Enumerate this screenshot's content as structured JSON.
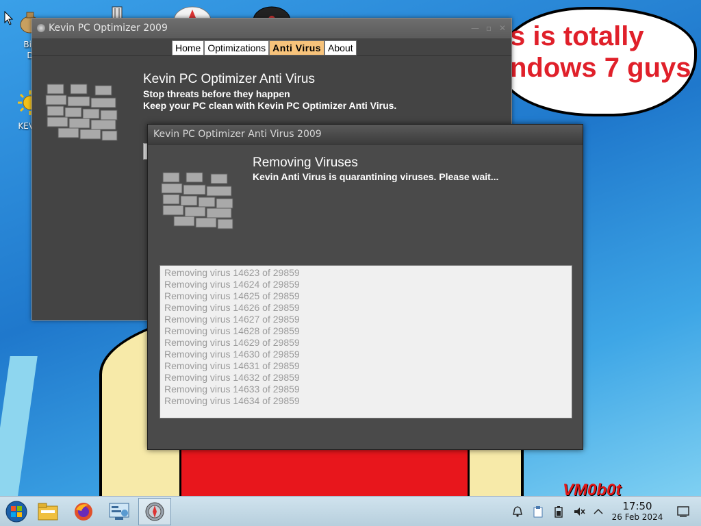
{
  "desktop": {
    "speech_text": "s is totally\nndows 7 guys",
    "watermark": "VM0b0t",
    "icons": [
      {
        "label": "Big\nD"
      },
      {
        "label": "KEVI"
      }
    ]
  },
  "main_window": {
    "title": "Kevin PC Optimizer 2009",
    "tabs": [
      {
        "label": "Home"
      },
      {
        "label": "Optimizations"
      },
      {
        "label": "Anti Virus"
      },
      {
        "label": "About"
      }
    ],
    "active_tab": "Anti Virus",
    "heading": "Kevin PC Optimizer Anti Virus",
    "subtitle_1": "Stop threats before they happen",
    "subtitle_2": "Keep your PC clean with Kevin PC Optimizer Anti Virus."
  },
  "av_dialog": {
    "title": "Kevin PC Optimizer Anti Virus 2009",
    "heading": "Removing Viruses",
    "message": "Kevin Anti Virus is quarantining viruses. Please wait...",
    "log": [
      "Removing virus 14623 of 29859",
      "Removing virus 14624 of 29859",
      "Removing virus 14625 of 29859",
      "Removing virus 14626 of 29859",
      "Removing virus 14627 of 29859",
      "Removing virus 14628 of 29859",
      "Removing virus 14629 of 29859",
      "Removing virus 14630 of 29859",
      "Removing virus 14631 of 29859",
      "Removing virus 14632 of 29859",
      "Removing virus 14633 of 29859",
      "Removing virus 14634 of 29859"
    ]
  },
  "taskbar": {
    "items": [
      "start-orb-icon",
      "file-manager-icon",
      "firefox-icon",
      "control-panel-icon",
      "kevin-optimizer-icon"
    ],
    "tray": [
      "notifications-icon",
      "clipboard-icon",
      "battery-icon",
      "volume-muted-icon",
      "chevron-up-icon",
      "show-desktop-icon"
    ],
    "time": "17:50",
    "date": "26 Feb 2024"
  },
  "colors": {
    "active_tab": "#f7c37b",
    "window_bg": "#444444",
    "log_text": "#9a9a9a"
  }
}
